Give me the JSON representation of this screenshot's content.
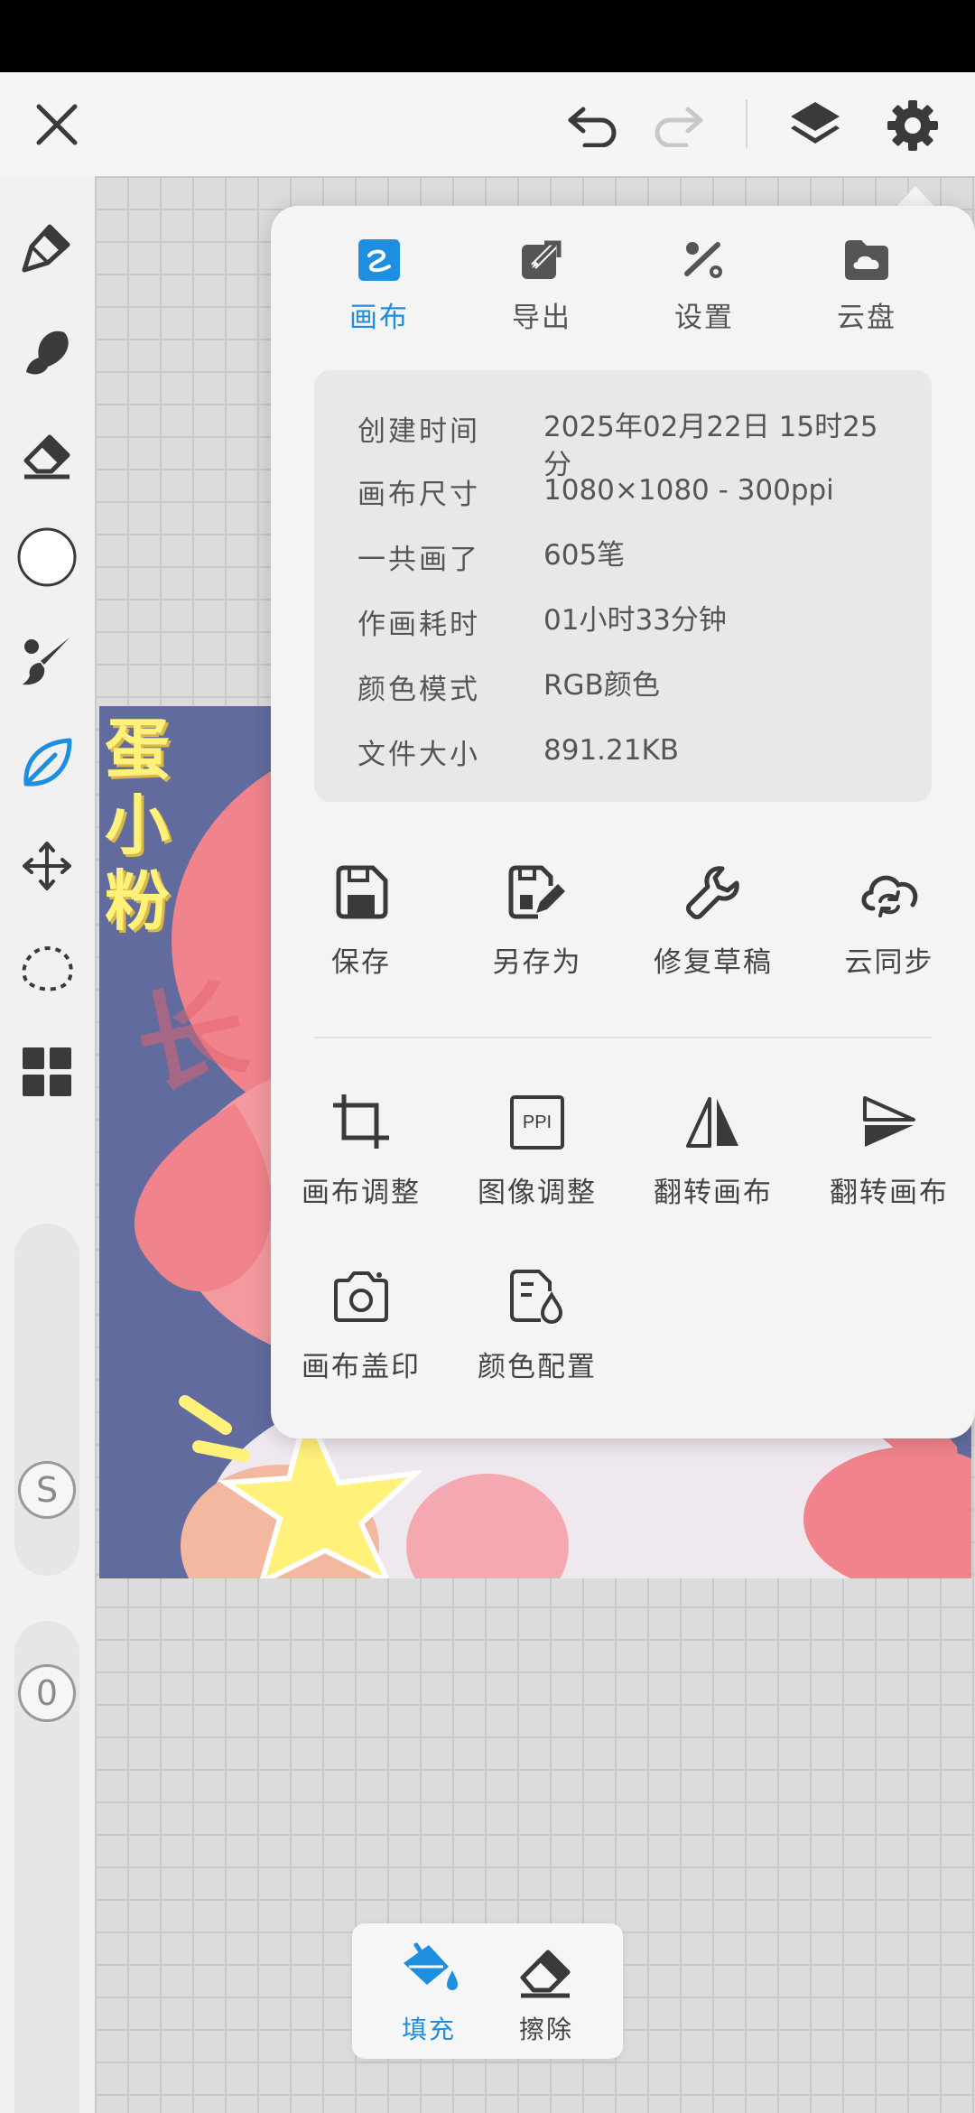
{
  "colors": {
    "accent": "#1e8ee0",
    "icon": "#3a3a3a",
    "panel": "#f4f4f4",
    "artwork_bg": "#626b9e",
    "artwork_pink": "#f1838c",
    "artwork_yellow": "#fff17a"
  },
  "top_bar": {
    "icons": [
      "close-icon",
      "undo-icon",
      "redo-icon",
      "layers-icon",
      "gear-icon"
    ]
  },
  "left_toolbar": {
    "icons": [
      "pen-icon",
      "smudge-icon",
      "eraser-icon",
      "color-circle-icon",
      "brush-icon",
      "leaf-icon",
      "move-icon",
      "lasso-icon",
      "grid-icon"
    ],
    "size_slider_label": "S",
    "opacity_slider_label": "0"
  },
  "artwork": {
    "title_chars": [
      "蛋",
      "小",
      "粉"
    ],
    "watermark": "长"
  },
  "panel": {
    "tabs": [
      {
        "label": "画布",
        "icon": "canvas-icon",
        "active": true
      },
      {
        "label": "导出",
        "icon": "export-icon",
        "active": false
      },
      {
        "label": "设置",
        "icon": "settings-icon",
        "active": false
      },
      {
        "label": "云盘",
        "icon": "cloud-drive-icon",
        "active": false
      }
    ],
    "info": [
      {
        "key": "创建时间",
        "value": "2025年02月22日 15时25分"
      },
      {
        "key": "画布尺寸",
        "value": "1080×1080 - 300ppi"
      },
      {
        "key": "一共画了",
        "value": "605笔"
      },
      {
        "key": "作画耗时",
        "value": "01小时33分钟"
      },
      {
        "key": "颜色模式",
        "value": "RGB颜色"
      },
      {
        "key": "文件大小",
        "value": "891.21KB"
      }
    ],
    "actions_row1": [
      {
        "label": "保存",
        "icon": "save-icon"
      },
      {
        "label": "另存为",
        "icon": "save-as-icon"
      },
      {
        "label": "修复草稿",
        "icon": "wrench-icon"
      },
      {
        "label": "云同步",
        "icon": "cloud-sync-icon"
      }
    ],
    "actions_row2": [
      {
        "label": "画布调整",
        "icon": "crop-icon"
      },
      {
        "label": "图像调整",
        "icon": "ppi-icon",
        "icon_text": "PPI"
      },
      {
        "label": "翻转画布",
        "icon": "flip-horizontal-icon"
      },
      {
        "label": "翻转画布",
        "icon": "flip-vertical-icon"
      }
    ],
    "actions_row3": [
      {
        "label": "画布盖印",
        "icon": "camera-icon"
      },
      {
        "label": "颜色配置",
        "icon": "color-profile-icon"
      }
    ]
  },
  "bottom_bar": {
    "fill_label": "填充",
    "erase_label": "擦除"
  }
}
